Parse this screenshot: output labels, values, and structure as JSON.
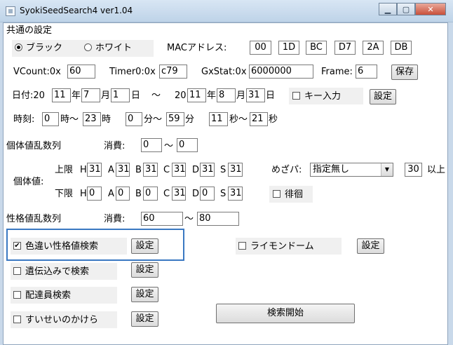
{
  "window": {
    "title": "SyokiSeedSearch4 ver1.04"
  },
  "common": {
    "heading": "共通の設定",
    "radio_black": "ブラック",
    "radio_white": "ホワイト",
    "mac_label": "MACアドレス:",
    "mac": [
      "00",
      "1D",
      "BC",
      "D7",
      "2A",
      "DB"
    ],
    "vcount_label": "VCount:0x",
    "vcount": "60",
    "timer_label": "Timer0:0x",
    "timer": "c79",
    "gxstat_label": "GxStat:0x",
    "gxstat": "6000000",
    "frame_label": "Frame:",
    "frame": "6",
    "save_button": "保存"
  },
  "date": {
    "label": "日付:20",
    "from_year": "11",
    "from_month": "7",
    "from_day": "1",
    "to_prefix": "20",
    "to_year": "11",
    "to_month": "8",
    "to_day": "31",
    "year": "年",
    "month": "月",
    "day": "日",
    "tilde": "～",
    "key_input": "キー入力",
    "settings": "設定"
  },
  "time": {
    "label": "時刻:",
    "hour_from": "0",
    "hour_to": "23",
    "minute_from": "0",
    "minute_to": "59",
    "second_from": "11",
    "second_to": "21",
    "hour_unit_range": "時～",
    "hour_unit": "時",
    "minute_unit_range": "分～",
    "minute_unit": "分",
    "second_unit_range": "秒～",
    "second_unit": "秒"
  },
  "iv_rng": {
    "label": "個体値乱数列",
    "consume_label": "消費:",
    "from": "0",
    "tilde": "～",
    "to": "0"
  },
  "iv": {
    "label": "個体値:",
    "upper_label": "上限",
    "lower_label": "下限",
    "stat_labels": [
      "H",
      "A",
      "B",
      "C",
      "D",
      "S"
    ],
    "upper": [
      "31",
      "31",
      "31",
      "31",
      "31",
      "31"
    ],
    "lower": [
      "0",
      "0",
      "0",
      "31",
      "0",
      "31"
    ],
    "nature_label": "めざパ:",
    "nature_value": "指定無し",
    "power": "30",
    "power_suffix": "以上",
    "wander": "徘徊"
  },
  "nature_rng": {
    "label": "性格値乱数列",
    "consume_label": "消費:",
    "from": "60",
    "tilde": "～",
    "to": "80"
  },
  "options": {
    "shiny": "色違い性格値検索",
    "inherit": "遺伝込みで検索",
    "delivery": "配達員検索",
    "suisei": "すいせいのかけら",
    "raimon": "ライモンドーム",
    "settings": "設定",
    "check_mark": "✔"
  },
  "search_button": "検索開始"
}
